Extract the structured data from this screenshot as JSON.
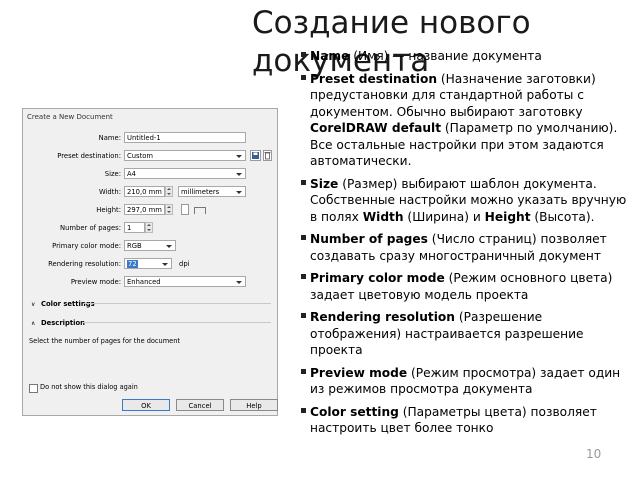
{
  "slide": {
    "title": "Создание нового документа",
    "page_number": "10"
  },
  "dialog": {
    "title": "Create a New Document",
    "fields": {
      "name": {
        "label": "Name:",
        "value": "Untitled-1"
      },
      "preset": {
        "label": "Preset destination:",
        "value": "Custom"
      },
      "size": {
        "label": "Size:",
        "value": "A4"
      },
      "width": {
        "label": "Width:",
        "value": "210,0 mm",
        "unit": "millimeters"
      },
      "height": {
        "label": "Height:",
        "value": "297,0 mm"
      },
      "pages": {
        "label": "Number of pages:",
        "value": "1"
      },
      "color_mode": {
        "label": "Primary color mode:",
        "value": "RGB"
      },
      "resolution": {
        "label": "Rendering resolution:",
        "value": "72",
        "unit": "dpi"
      },
      "preview": {
        "label": "Preview mode:",
        "value": "Enhanced"
      }
    },
    "color_settings_label": "Color settings",
    "description_label": "Description",
    "description_text": "Select the number of pages for the document",
    "dont_show_label": "Do not show this dialog again",
    "buttons": {
      "ok": "OK",
      "cancel": "Cancel",
      "help": "Help"
    }
  },
  "bullets": [
    {
      "bold": "Name",
      "text": " (Имя) — название документа"
    },
    {
      "bold": "Preset destination",
      "text": " (Назначение заготовки) предустановки для стандартной работы с документом. Обычно выбирают заготовку ",
      "bold2": "CorelDRAW default",
      "text2": " (Параметр по умолчанию). Все остальные настройки при этом задаются автоматически."
    },
    {
      "bold": "Size",
      "text": " (Размер) выбирают шаблон документа. Собственные настройки можно указать вручную в полях ",
      "bold2": "Width",
      "text2": " (Ширина) и ",
      "bold3": "Height",
      "text3": " (Высота)."
    },
    {
      "bold": " Number of pages",
      "text": " (Число страниц) позволяет создавать сразу многостраничный документ"
    },
    {
      "bold": "Primary color mode",
      "text": " (Режим основного цвета) задает цветовую модель проекта"
    },
    {
      "bold": "Rendering resolution",
      "text": " (Разрешение отображения) настраивается разрешение проекта"
    },
    {
      "bold": "Preview mode",
      "text": " (Режим просмотра) задает один из режимов просмотра документа"
    },
    {
      "bold": "Color setting",
      "text": " (Параметры цвета) позволяет настроить цвет более тонко"
    }
  ]
}
